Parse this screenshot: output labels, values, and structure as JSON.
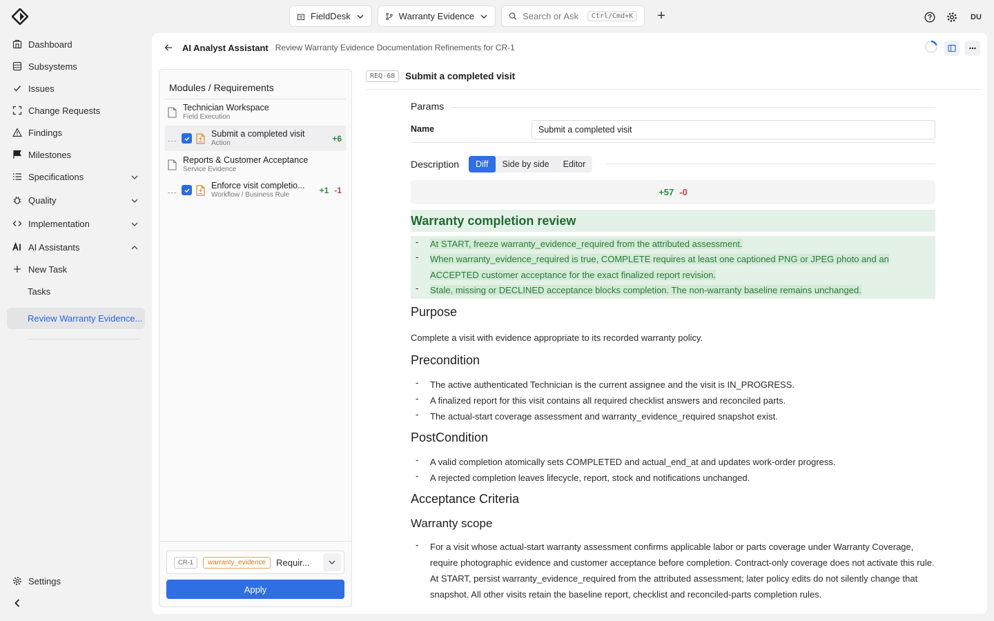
{
  "topbar": {
    "project": "FieldDesk",
    "branch": "Warranty Evidence",
    "search_placeholder": "Search or Ask",
    "search_shortcut": "Ctrl/Cmd+K",
    "avatar": "DU"
  },
  "sidebar": {
    "items": [
      {
        "label": "Dashboard",
        "icon": "dashboard-icon"
      },
      {
        "label": "Subsystems",
        "icon": "database-icon"
      },
      {
        "label": "Issues",
        "icon": "check-icon"
      },
      {
        "label": "Change Requests",
        "icon": "expand-icon"
      },
      {
        "label": "Findings",
        "icon": "warning-icon"
      },
      {
        "label": "Milestones",
        "icon": "flag-icon"
      },
      {
        "label": "Specifications",
        "icon": "list-icon"
      },
      {
        "label": "Quality",
        "icon": "bug-icon"
      },
      {
        "label": "Implementation",
        "icon": "code-icon"
      },
      {
        "label": "AI Assistants",
        "icon": "ai-icon"
      },
      {
        "label": "New Task",
        "icon": "plus-icon"
      },
      {
        "label": "Tasks"
      },
      {
        "label": "Review Warranty Evidence..."
      }
    ],
    "settings": "Settings"
  },
  "header": {
    "assistant": "AI Analyst Assistant",
    "task": "Review Warranty Evidence Documentation Refinements for CR-1"
  },
  "modules": {
    "title": "Modules / Requirements",
    "rows": [
      {
        "name": "Technician Workspace",
        "sub": "Field Execution"
      },
      {
        "name": "Submit a completed visit",
        "sub": "Action",
        "plus": "+6"
      },
      {
        "name": "Reports & Customer Acceptance",
        "sub": "Service Evidence"
      },
      {
        "name": "Enforce visit completio...",
        "sub": "Workflow / Business Rule",
        "plus": "+1",
        "minus": "-1"
      }
    ],
    "cr_tag": "CR-1",
    "evidence_tag": "warranty_evidence",
    "req_short": "Requir...",
    "apply": "Apply"
  },
  "requirement": {
    "id": "REQ-68",
    "title": "Submit a completed visit",
    "params_label": "Params",
    "name_label": "Name",
    "name_value": "Submit a completed visit",
    "description_label": "Description",
    "tabs": [
      "Diff",
      "Side by side",
      "Editor"
    ],
    "stat_plus": "+57",
    "stat_minus": "-0",
    "added_heading": "Warranty completion review",
    "added_items": [
      "At START, freeze warranty_evidence_required from the attributed assessment.",
      "When warranty_evidence_required is true, COMPLETE requires at least one captioned PNG or JPEG photo and an ACCEPTED customer acceptance for the exact finalized report revision.",
      "Stale, missing or DECLINED acceptance blocks completion. The non-warranty baseline remains unchanged."
    ],
    "purpose_heading": "Purpose",
    "purpose_text": "Complete a visit with evidence appropriate to its recorded warranty policy.",
    "precondition_heading": "Precondition",
    "precondition_items": [
      "The active authenticated Technician is the current assignee and the visit is IN_PROGRESS.",
      "A finalized report for this visit contains all required checklist answers and reconciled parts.",
      "The actual-start coverage assessment and warranty_evidence_required snapshot exist."
    ],
    "postcondition_heading": "PostCondition",
    "postcondition_items": [
      "A valid completion atomically sets COMPLETED and actual_end_at and updates work-order progress.",
      "A rejected completion leaves lifecycle, report, stock and notifications unchanged."
    ],
    "acceptance_heading": "Acceptance Criteria",
    "warranty_heading": "Warranty scope",
    "warranty_items": [
      "For a visit whose actual-start warranty assessment confirms applicable labor or parts coverage under Warranty Coverage, require photographic evidence and customer acceptance before completion. Contract-only coverage does not activate this rule. At START, persist warranty_evidence_required from the attributed assessment; later policy edits do not silently change that snapshot. All other visits retain the baseline report, checklist and reconciled-parts completion rules."
    ]
  }
}
